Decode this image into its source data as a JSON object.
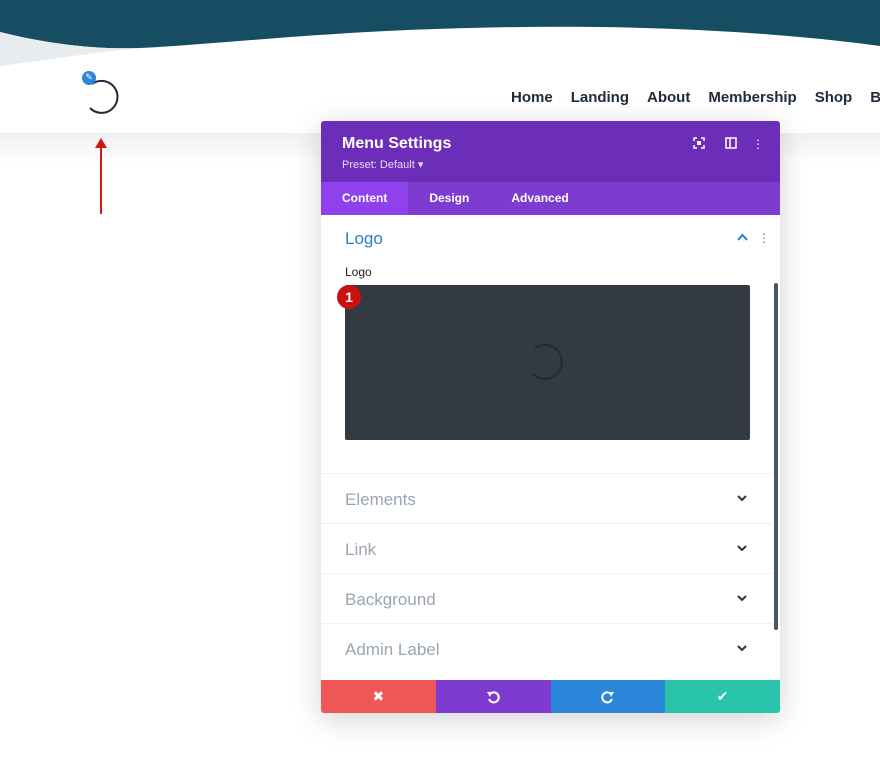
{
  "site": {
    "nav": [
      "Home",
      "Landing",
      "About",
      "Membership",
      "Shop",
      "Bl"
    ],
    "edit_icon": "pencil-icon",
    "colors": {
      "wave": "#174d62",
      "nav_text": "#1f2b3a"
    }
  },
  "annotation": {
    "arrow_icon": "arrow-up-icon",
    "step_number": "1"
  },
  "modal": {
    "title": "Menu Settings",
    "preset": "Preset: Default ▾",
    "header_icons": [
      "fullscreen-icon",
      "split-view-icon",
      "more-options-icon"
    ],
    "tabs": [
      {
        "label": "Content",
        "active": true
      },
      {
        "label": "Design",
        "active": false
      },
      {
        "label": "Advanced",
        "active": false
      }
    ],
    "logo_section": {
      "title": "Logo",
      "field_label": "Logo",
      "expanded": true
    },
    "sections": [
      {
        "label": "Elements"
      },
      {
        "label": "Link"
      },
      {
        "label": "Background"
      },
      {
        "label": "Admin Label"
      }
    ],
    "footer": {
      "close_icon": "close-icon",
      "undo_icon": "undo-icon",
      "redo_icon": "redo-icon",
      "save_icon": "check-icon"
    },
    "colors": {
      "header": "#6c2eb9",
      "tabs": "#7e3bd0",
      "active_tab": "#8f42ec",
      "section_title": "#2e7cc5",
      "close": "#ef5656",
      "undo": "#7e3bd0",
      "redo": "#2b87da",
      "save": "#29c4a9"
    }
  }
}
